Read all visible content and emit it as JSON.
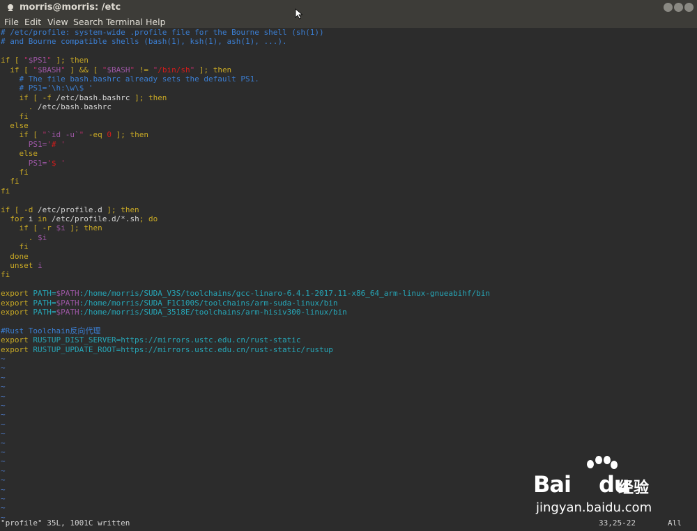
{
  "window": {
    "title": "morris@morris: /etc"
  },
  "menu": [
    "File",
    "Edit",
    "View",
    "Search",
    "Terminal",
    "Help"
  ],
  "colors": {
    "comment": "#3b7ed2",
    "keyword": "#c7a825",
    "string": "#b32f67",
    "variable": "#9b56a3",
    "path": "#26a6b7",
    "text": "#d3d3d3",
    "tilde": "#4f7bc8",
    "background": "#2c2c2c"
  },
  "file_lines": [
    [
      {
        "t": "# /etc/profile: system-wide .profile file for the Bourne shell (sh(1))",
        "c": "comment"
      }
    ],
    [
      {
        "t": "# and Bourne compatible shells (bash(1), ksh(1), ash(1), ...).",
        "c": "comment"
      }
    ],
    [],
    [
      {
        "t": "if [ ",
        "c": "kw"
      },
      {
        "t": "\"",
        "c": "str"
      },
      {
        "t": "$PS1",
        "c": "var"
      },
      {
        "t": "\"",
        "c": "str"
      },
      {
        "t": " ]; then",
        "c": "kw"
      }
    ],
    [
      {
        "t": "  if [ ",
        "c": "kw"
      },
      {
        "t": "\"",
        "c": "str"
      },
      {
        "t": "$BASH",
        "c": "var"
      },
      {
        "t": "\"",
        "c": "str"
      },
      {
        "t": " ] && [ ",
        "c": "kw"
      },
      {
        "t": "\"",
        "c": "str"
      },
      {
        "t": "$BASH",
        "c": "var"
      },
      {
        "t": "\"",
        "c": "str"
      },
      {
        "t": " != ",
        "c": "kw"
      },
      {
        "t": "\"",
        "c": "str"
      },
      {
        "t": "/bin/sh",
        "c": "red"
      },
      {
        "t": "\"",
        "c": "str"
      },
      {
        "t": " ]; then",
        "c": "kw"
      }
    ],
    [
      {
        "t": "    # The file bash.bashrc already sets the default PS1.",
        "c": "comment"
      }
    ],
    [
      {
        "t": "    # PS1='\\h:\\w\\$ '",
        "c": "comment"
      }
    ],
    [
      {
        "t": "    if [ -f ",
        "c": "kw"
      },
      {
        "t": "/etc/bash.bashrc",
        "c": "text"
      },
      {
        "t": " ]; then",
        "c": "kw"
      }
    ],
    [
      {
        "t": "      . ",
        "c": "kw"
      },
      {
        "t": "/etc/bash.bashrc",
        "c": "text"
      }
    ],
    [
      {
        "t": "    fi",
        "c": "kw"
      }
    ],
    [
      {
        "t": "  else",
        "c": "kw"
      }
    ],
    [
      {
        "t": "    if [ ",
        "c": "kw"
      },
      {
        "t": "\"",
        "c": "str"
      },
      {
        "t": "`id -u`",
        "c": "var"
      },
      {
        "t": "\"",
        "c": "str"
      },
      {
        "t": " -eq ",
        "c": "kw"
      },
      {
        "t": "0",
        "c": "red"
      },
      {
        "t": " ]; then",
        "c": "kw"
      }
    ],
    [
      {
        "t": "      ",
        "c": "text"
      },
      {
        "t": "PS1=",
        "c": "var"
      },
      {
        "t": "'",
        "c": "str"
      },
      {
        "t": "# ",
        "c": "red"
      },
      {
        "t": "'",
        "c": "str"
      }
    ],
    [
      {
        "t": "    else",
        "c": "kw"
      }
    ],
    [
      {
        "t": "      ",
        "c": "text"
      },
      {
        "t": "PS1=",
        "c": "var"
      },
      {
        "t": "'",
        "c": "str"
      },
      {
        "t": "$ ",
        "c": "red"
      },
      {
        "t": "'",
        "c": "str"
      }
    ],
    [
      {
        "t": "    fi",
        "c": "kw"
      }
    ],
    [
      {
        "t": "  fi",
        "c": "kw"
      }
    ],
    [
      {
        "t": "fi",
        "c": "kw"
      }
    ],
    [],
    [
      {
        "t": "if [ -d ",
        "c": "kw"
      },
      {
        "t": "/etc/profile.d",
        "c": "text"
      },
      {
        "t": " ]; then",
        "c": "kw"
      }
    ],
    [
      {
        "t": "  for ",
        "c": "kw"
      },
      {
        "t": "i",
        "c": "text"
      },
      {
        "t": " in ",
        "c": "kw"
      },
      {
        "t": "/etc/profile.d/*.sh",
        "c": "text"
      },
      {
        "t": "; do",
        "c": "kw"
      }
    ],
    [
      {
        "t": "    if [ -r ",
        "c": "kw"
      },
      {
        "t": "$i",
        "c": "var"
      },
      {
        "t": " ]; then",
        "c": "kw"
      }
    ],
    [
      {
        "t": "      . ",
        "c": "kw"
      },
      {
        "t": "$i",
        "c": "var"
      }
    ],
    [
      {
        "t": "    fi",
        "c": "kw"
      }
    ],
    [
      {
        "t": "  done",
        "c": "kw"
      }
    ],
    [
      {
        "t": "  unset ",
        "c": "kw"
      },
      {
        "t": "i",
        "c": "var"
      }
    ],
    [
      {
        "t": "fi",
        "c": "kw"
      }
    ],
    [],
    [
      {
        "t": "export ",
        "c": "kw"
      },
      {
        "t": "PATH=",
        "c": "path"
      },
      {
        "t": "$PATH",
        "c": "var"
      },
      {
        "t": ":/home/morris/SUDA_V3S/toolchains/gcc-linaro-6.4.1-2017.11-x86_64_arm-linux-gnueabihf/bin",
        "c": "path"
      }
    ],
    [
      {
        "t": "export ",
        "c": "kw"
      },
      {
        "t": "PATH=",
        "c": "path"
      },
      {
        "t": "$PATH",
        "c": "var"
      },
      {
        "t": ":/home/morris/SUDA_F1C100S/toolchains/arm-suda-linux/bin",
        "c": "path"
      }
    ],
    [
      {
        "t": "export ",
        "c": "kw"
      },
      {
        "t": "PATH=",
        "c": "path"
      },
      {
        "t": "$PATH",
        "c": "var"
      },
      {
        "t": ":/home/morris/SUDA_3518E/toolchains/arm-hisiv300-linux/bin",
        "c": "path"
      }
    ],
    [],
    [
      {
        "t": "#Rust Toolchain反向代理",
        "c": "comment"
      }
    ],
    [
      {
        "t": "export ",
        "c": "kw"
      },
      {
        "t": "RUSTUP_DIST_SERVER=https://mirrors.ustc.edu.cn/rust-static",
        "c": "path"
      }
    ],
    [
      {
        "t": "export ",
        "c": "kw"
      },
      {
        "t": "RUSTUP_UPDATE_ROOT=https://mirrors.ustc.edu.cn/rust-static/rustup",
        "c": "path"
      }
    ]
  ],
  "empty_line_count": 18,
  "empty_line_marker": "~",
  "status": {
    "message": "\"profile\" 35L, 1001C written",
    "position": "33,25-22",
    "scroll": "All"
  },
  "watermark": {
    "brand": "Bai",
    "brand_suffix": "du",
    "cn": "经验",
    "url": "jingyan.baidu.com"
  }
}
